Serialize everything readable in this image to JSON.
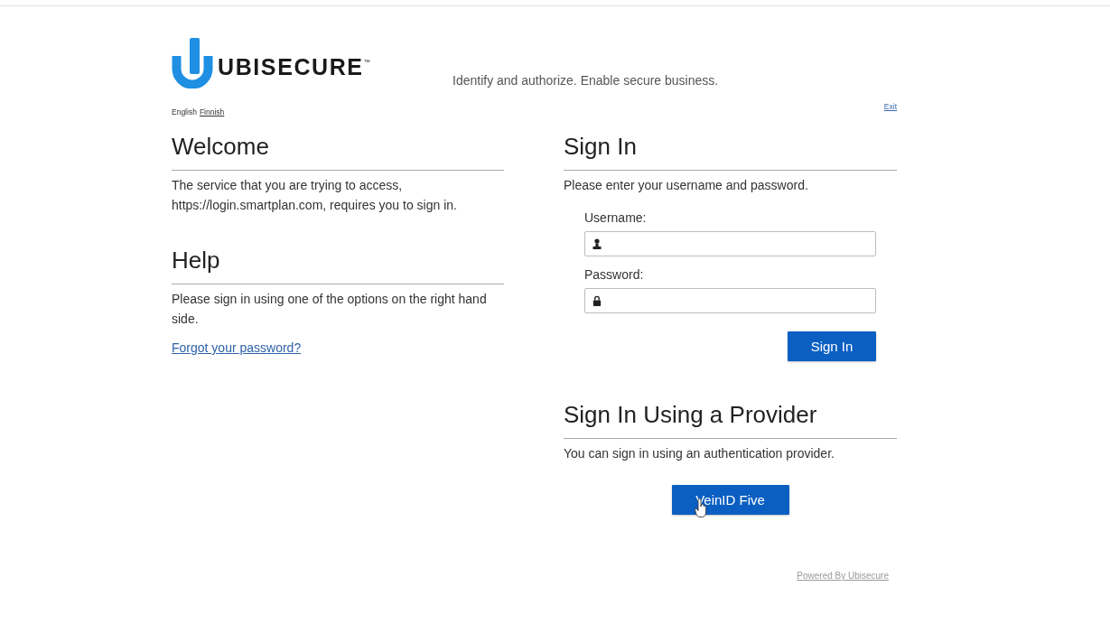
{
  "header": {
    "brand": "UBISECURE",
    "trademark": "™",
    "tagline": "Identify and authorize. Enable secure business."
  },
  "languages": [
    {
      "label": "English",
      "selected": true
    },
    {
      "label": "Finnish",
      "selected": false
    }
  ],
  "exit_link": "Exit",
  "welcome": {
    "title": "Welcome",
    "text": "The service that you are trying to access, https://login.smartplan.com, requires you to sign in."
  },
  "help": {
    "title": "Help",
    "text": "Please sign in using one of the options on the right hand side.",
    "link": "Forgot your password?"
  },
  "sign_in": {
    "title": "Sign In",
    "instructions": "Please enter your username and password.",
    "fields": [
      {
        "label": "Username:",
        "kind": "user"
      },
      {
        "label": "Password:",
        "kind": "password"
      }
    ],
    "button": "Sign In"
  },
  "providers": {
    "title": "Sign In Using a Provider",
    "text": "You can sign in using an authentication provider.",
    "buttons": [
      "VeinID Five"
    ]
  },
  "footer": {
    "link": "Powered By Ubisecure"
  }
}
